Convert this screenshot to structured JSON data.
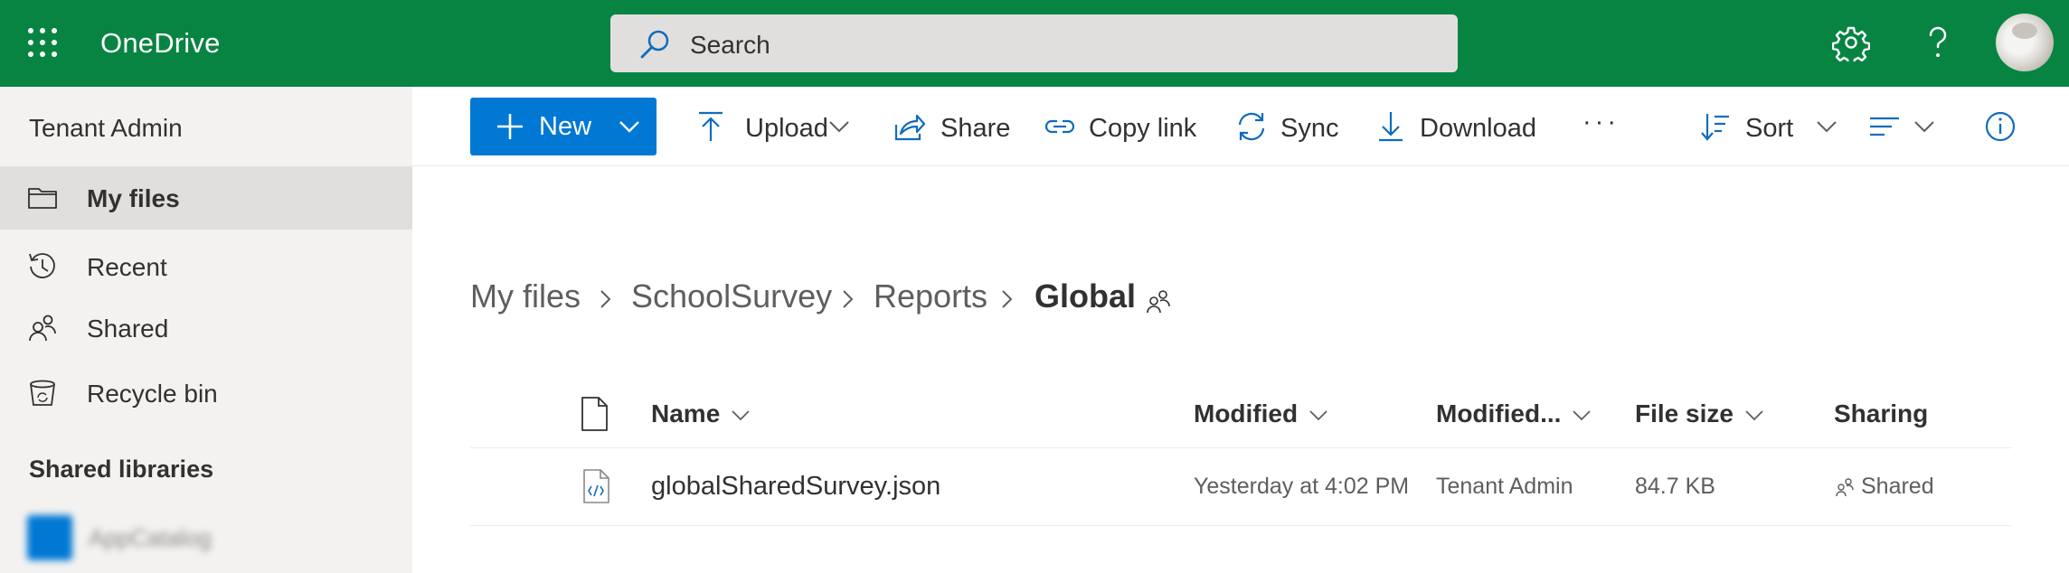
{
  "header": {
    "app_title": "OneDrive",
    "search_placeholder": "Search",
    "icons": [
      "app-launcher-icon",
      "settings-icon",
      "help-icon",
      "avatar"
    ],
    "brand_color": "#088442"
  },
  "sidebar": {
    "user_name": "Tenant Admin",
    "items": [
      {
        "label": "My files",
        "icon": "folder-icon",
        "active": true
      },
      {
        "label": "Recent",
        "icon": "history-icon"
      },
      {
        "label": "Shared",
        "icon": "people-icon"
      },
      {
        "label": "Recycle bin",
        "icon": "recycle-bin-icon"
      }
    ],
    "section_title": "Shared libraries",
    "libraries": [
      {
        "label": "AppCatalog"
      }
    ]
  },
  "commandbar": {
    "new_label": "New",
    "upload_label": "Upload",
    "share_label": "Share",
    "copy_link_label": "Copy link",
    "sync_label": "Sync",
    "download_label": "Download",
    "more_label": "···",
    "sort_label": "Sort",
    "accent_color": "#0078d4"
  },
  "breadcrumb": [
    "My files",
    "SchoolSurvey",
    "Reports",
    "Global"
  ],
  "table": {
    "columns": [
      "Name",
      "Modified",
      "Modified...",
      "File size",
      "Sharing"
    ],
    "rows": [
      {
        "name": "globalSharedSurvey.json",
        "modified": "Yesterday at 4:02 PM",
        "modified_by": "Tenant Admin",
        "file_size": "84.7 KB",
        "sharing": "Shared"
      }
    ]
  }
}
